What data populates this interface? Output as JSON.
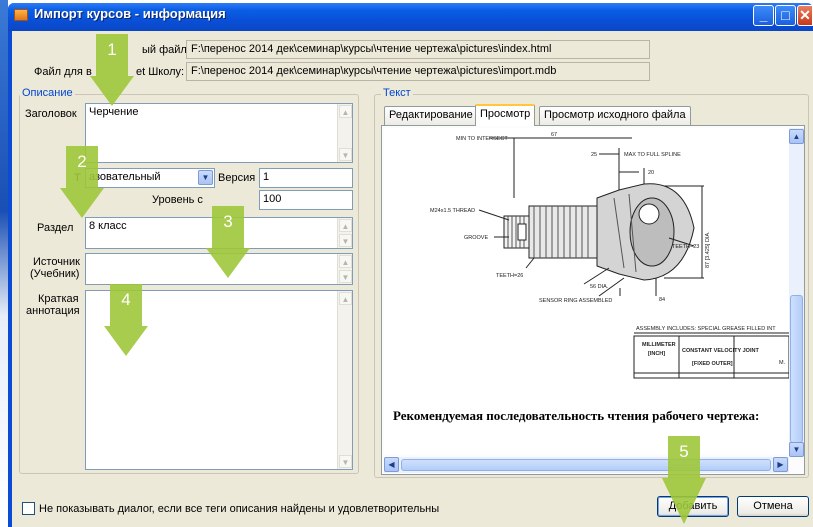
{
  "window": {
    "title": "Импорт курсов - информация"
  },
  "header": {
    "source_label": "ый файл:",
    "source_value": "F:\\перенос 2014 дек\\семинар\\курсы\\чтение чертежа\\pictures\\index.html",
    "target_label_left": "Файл для в",
    "target_label_right": "et Школу:",
    "target_value": "F:\\перенос 2014 дек\\семинар\\курсы\\чтение чертежа\\pictures\\import.mdb"
  },
  "description": {
    "group_title": "Описание",
    "heading_label": "Заголовок",
    "heading_value": "Черчение",
    "type_label": "Т",
    "type_value": "азовательный",
    "version_label": "Версия",
    "version_value": "1",
    "level_label": "Уровень с",
    "level_value": "100",
    "section_label": "Раздел",
    "section_value": "8 класс",
    "source_label_line1": "Источник",
    "source_label_line2": "(Учебник)",
    "source_value": "",
    "summary_label_line1": "Краткая",
    "summary_label_line2": "аннотация",
    "summary_value": ""
  },
  "text_panel": {
    "group_title": "Текст",
    "tabs": [
      {
        "label": "Редактирование",
        "active": false
      },
      {
        "label": "Просмотр",
        "active": true
      },
      {
        "label": "Просмотр исходного файла",
        "active": false
      }
    ],
    "drawing_labels": {
      "min_to_intersect": "MIN TO INTERSECT",
      "dim_67": "67",
      "dim_25": "25",
      "max_to_full_spline": "MAX TO FULL SPLINE",
      "dim_20": "20",
      "thread": "M24x1.5 THREAD",
      "groove": "GROOVE",
      "teeth_26": "TEETH=26",
      "teeth_23": "TEETH=23",
      "dia_56": "56 DIA.",
      "dim_84": "84",
      "dia_87": "87 [3.425] DIA.",
      "sensor_ring": "SENSOR RING ASSEMBLED",
      "assembly_includes": "ASSEMBLY INCLUDES: SPECIAL GREASE FILLED INT",
      "millimeter": "MILLIMETER",
      "inch": "[INCH]",
      "cv_joint": "CONSTANT VELOCITY JOINT",
      "fixed_outer": "[FIXED OUTER]",
      "corner_m": "M."
    },
    "recommendation": "Рекомендуемая последовательность чтения рабочего чертежа:"
  },
  "footer": {
    "checkbox_label": "Не показывать диалог, если все теги описания найдены и удовлетворительны",
    "checkbox_checked": false,
    "add_button": "Добавить",
    "cancel_button": "Отмена"
  },
  "markers": [
    "1",
    "2",
    "3",
    "4",
    "5"
  ],
  "colors": {
    "marker_green": "#9fc73a",
    "title_blue": "#0a5ee6",
    "group_title": "#0046d5",
    "dialog_bg": "#ece9d8"
  }
}
